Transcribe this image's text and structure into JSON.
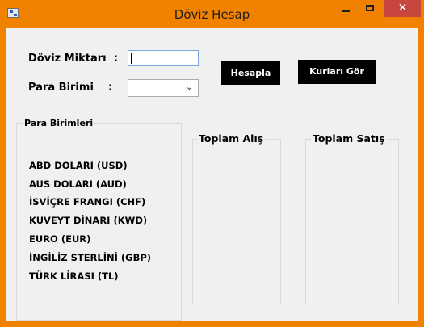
{
  "window": {
    "title": "Döviz Hesap",
    "close_glyph": "✕"
  },
  "form": {
    "amount_label": "Döviz Miktarı  :",
    "amount_value": "",
    "currency_label": "Para Birimi    :",
    "currency_value": ""
  },
  "buttons": {
    "calculate": "Hesapla",
    "show_rates": "Kurları Gör"
  },
  "groups": {
    "currencies_title": "Para Birimleri",
    "total_buy_title": "Toplam Alış",
    "total_sell_title": "Toplam Satış"
  },
  "currencies": [
    "ABD DOLARI (USD)",
    "AUS DOLARI (AUD)",
    "İSVİÇRE FRANGI (CHF)",
    "KUVEYT DİNARI (KWD)",
    "EURO (EUR)",
    "İNGİLİZ STERLİNİ (GBP)",
    "TÜRK LİRASI (TL)"
  ]
}
